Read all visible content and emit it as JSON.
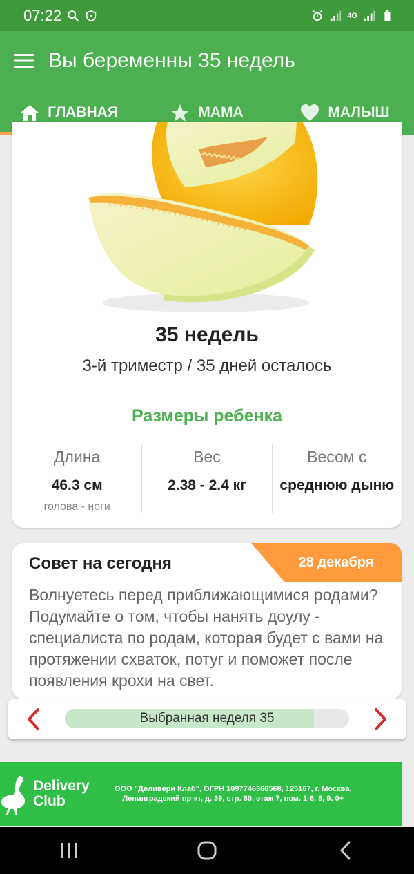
{
  "status_bar": {
    "time": "07:22",
    "network": "4G"
  },
  "app_bar": {
    "title": "Вы беременны 35 недель"
  },
  "tabs": [
    {
      "label": "ГЛАВНАЯ",
      "icon": "home-icon",
      "active": true
    },
    {
      "label": "МАМА",
      "icon": "star-icon",
      "active": false
    },
    {
      "label": "МАЛЫШ",
      "icon": "heart-icon",
      "active": false
    }
  ],
  "hero": {
    "image": "melon-icon",
    "week_title": "35 недель",
    "subtitle": "3-й триместр / 35 дней осталось",
    "sizes_title": "Размеры ребенка",
    "sizes": [
      {
        "label": "Длина",
        "value": "46.3 см",
        "note": "голова - ноги"
      },
      {
        "label": "Вес",
        "value": "2.38 - 2.4 кг",
        "note": ""
      },
      {
        "label": "Весом с",
        "value": "среднюю дыню",
        "note": ""
      }
    ]
  },
  "advice": {
    "title": "Совет на сегодня",
    "date": "28 декабря",
    "text": "Волнуетесь перед приближающимися родами? Подумайте о том, чтобы нанять доулу - специалиста по родам, которая будет с вами на протяжении схваток, потуг и поможет после появления крохи на свет."
  },
  "week_selector": {
    "label": "Выбранная неделя 35",
    "progress": 0.875
  },
  "ad": {
    "brand_line1": "Delivery",
    "brand_line2": "Club",
    "legal": "ООО \"Деливери Клаб\", ОГРН 1097746360568, 125167, г. Москва, Ленинградский пр-кт, д. 39, стр. 80, этаж 7, пом. 1-6, 8, 9. 0+"
  },
  "colors": {
    "status_bar": "#3f9a3b",
    "app_bar": "#4caf50",
    "accent": "#ff9b3c",
    "progress_fill": "#c8e6c9",
    "ad_bg": "#2fbf47"
  }
}
